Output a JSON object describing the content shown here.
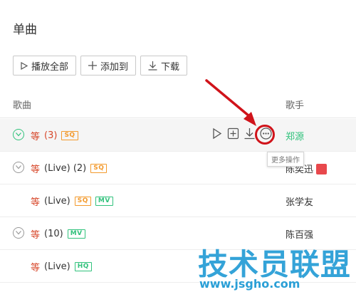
{
  "section_title": "单曲",
  "toolbar": {
    "play_all_label": "播放全部",
    "add_to_label": "添加到",
    "download_label": "下载"
  },
  "table": {
    "headers": {
      "song": "歌曲",
      "artist": "歌手"
    },
    "rows": [
      {
        "name": "等",
        "meta": "(3)",
        "badges": [
          "SQ"
        ],
        "artist": "郑源",
        "expandable": true,
        "hovered": true
      },
      {
        "name": "等",
        "meta": "(Live) (2)",
        "badges": [
          "SQ"
        ],
        "artist": "陈奕迅",
        "expandable": true,
        "hovered": false
      },
      {
        "name": "等",
        "meta": "(Live)",
        "badges": [
          "SQ",
          "MV"
        ],
        "artist": "张学友",
        "expandable": false,
        "hovered": false
      },
      {
        "name": "等",
        "meta": "(10)",
        "badges": [
          "MV"
        ],
        "artist": "陈百强",
        "expandable": true,
        "hovered": false
      },
      {
        "name": "等",
        "meta": "(Live)",
        "badges": [
          "HQ"
        ],
        "artist": "",
        "expandable": false,
        "hovered": false
      }
    ]
  },
  "row_actions_icons": [
    "play-icon",
    "add-icon",
    "download-icon",
    "more-icon"
  ],
  "tooltip": "更多操作",
  "watermark": {
    "brand": "技术员联盟",
    "url": "www.jsgho.com"
  },
  "colors": {
    "accent_green": "#31c27c",
    "song_red": "#d7472a",
    "badge_orange": "#f39a2d",
    "annotation_red": "#d0131a",
    "watermark_blue": "#2a9fd6"
  }
}
